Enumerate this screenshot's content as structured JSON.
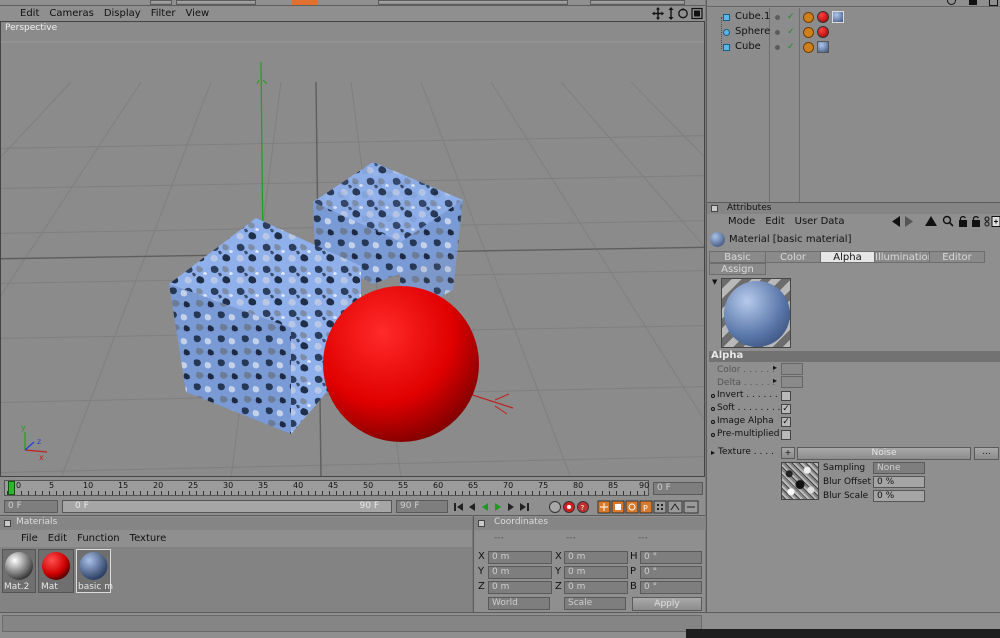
{
  "viewport": {
    "menu": [
      "Edit",
      "Cameras",
      "Display",
      "Filter",
      "View"
    ],
    "camera_label": "Perspective"
  },
  "objects": {
    "items": [
      {
        "name": "Cube.1"
      },
      {
        "name": "Sphere"
      },
      {
        "name": "Cube"
      }
    ]
  },
  "attributes": {
    "panel_title": "Attributes",
    "menu": [
      "Mode",
      "Edit",
      "User Data"
    ],
    "material_label": "Material [basic material]",
    "tabs": [
      "Basic",
      "Color",
      "Alpha",
      "Illumination",
      "Editor",
      "Assign"
    ],
    "active_tab": "Alpha",
    "section_title": "Alpha",
    "color_label": "Color . . . . . .",
    "delta_label": "Delta . . . . . .",
    "invert_label": "Invert . . . . . . .",
    "soft_label": "Soft . . . . . . . .",
    "image_alpha_label": "Image Alpha",
    "premultiplied_label": "Pre-multiplied",
    "texture_label": "Texture . . . .",
    "texture_value": "Noise",
    "texture_more": "...",
    "sampling_label": "Sampling",
    "sampling_value": "None",
    "blur_offset_label": "Blur Offset",
    "blur_offset_value": "0 %",
    "blur_scale_label": "Blur Scale",
    "blur_scale_value": "0 %",
    "invert": false,
    "soft": true,
    "image_alpha": true,
    "premultiplied": false
  },
  "timeline": {
    "ticks": [
      "0",
      "5",
      "10",
      "15",
      "20",
      "25",
      "30",
      "35",
      "40",
      "45",
      "50",
      "55",
      "60",
      "65",
      "70",
      "75",
      "80",
      "85",
      "90"
    ],
    "current_frame": "0 F",
    "start_frame": "0 F",
    "range_start": "0 F",
    "range_end": "90 F",
    "end_frame": "90 F"
  },
  "materials": {
    "title": "Materials",
    "menu": [
      "File",
      "Edit",
      "Function",
      "Texture"
    ],
    "items": [
      {
        "name": "Mat.2"
      },
      {
        "name": "Mat"
      },
      {
        "name": "basic m"
      }
    ]
  },
  "coordinates": {
    "title": "Coordinates",
    "headers": [
      "---",
      "---",
      "---"
    ],
    "rows": [
      {
        "a": "X",
        "av": "0 m",
        "b": "X",
        "bv": "0 m",
        "c": "H",
        "cv": "0 °"
      },
      {
        "a": "Y",
        "av": "0 m",
        "b": "Y",
        "bv": "0 m",
        "c": "P",
        "cv": "0 °"
      },
      {
        "a": "Z",
        "av": "0 m",
        "b": "Z",
        "bv": "0 m",
        "c": "B",
        "cv": "0 °"
      }
    ],
    "mode_world": "World",
    "mode_scale": "Scale",
    "apply": "Apply"
  },
  "colors": {
    "sphere": "#e00000",
    "cube": "#8eaee6",
    "panel": "#8f8f8f"
  }
}
